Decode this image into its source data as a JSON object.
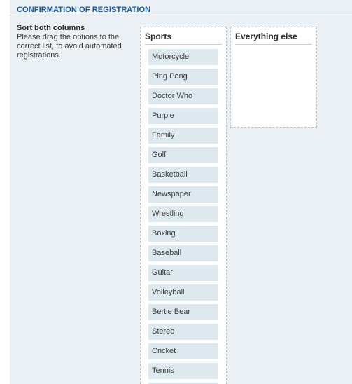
{
  "header": {
    "title": "CONFIRMATION OF REGISTRATION"
  },
  "instructions": {
    "heading": "Sort both columns",
    "text": "Please drag the options to the correct list, to avoid automated registrations."
  },
  "columns": {
    "sports": {
      "title": "Sports",
      "items": [
        "Motorcycle",
        "Ping Pong",
        "Doctor Who",
        "Purple",
        "Family",
        "Golf",
        "Basketball",
        "Newspaper",
        "Wrestling",
        "Boxing",
        "Baseball",
        "Guitar",
        "Volleyball",
        "Bertie Bear",
        "Stereo",
        "Cricket",
        "Tennis",
        ""
      ]
    },
    "everything_else": {
      "title": "Everything else",
      "items": []
    }
  },
  "colors": {
    "panel_background": "#eaf0f3",
    "title_blue": "#1d5a99",
    "item_background": "#dde8ef"
  }
}
